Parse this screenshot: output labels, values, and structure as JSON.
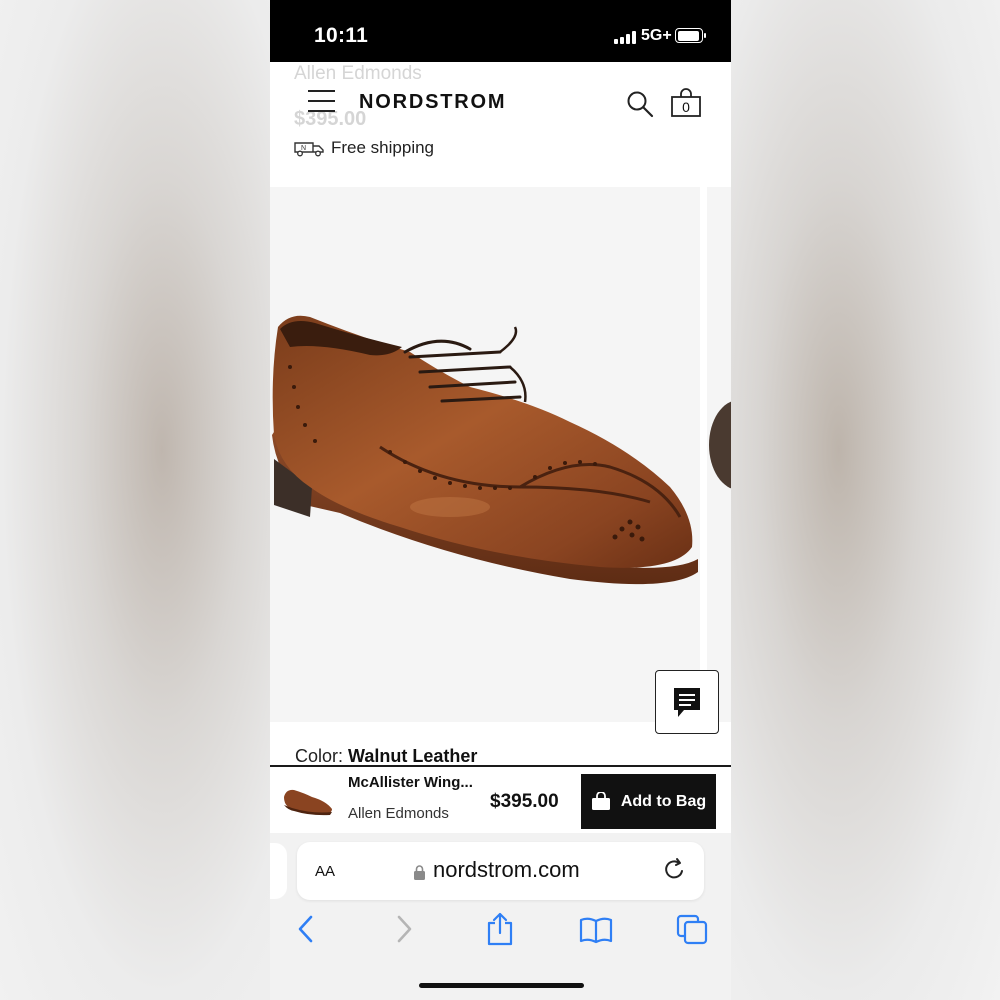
{
  "status_bar": {
    "time": "10:11",
    "network": "5G+"
  },
  "header": {
    "ghost_brand": "Allen Edmonds",
    "ghost_price": "$395.00",
    "logo": "NORDSTROM",
    "bag_count": "0",
    "shipping": "Free shipping"
  },
  "product": {
    "color_label": "Color: ",
    "color_value": "Walnut Leather"
  },
  "sticky_bar": {
    "name": "McAllister Wing...",
    "brand": "Allen Edmonds",
    "price": "$395.00",
    "add_label": "Add to Bag"
  },
  "browser": {
    "aa_label": "AA",
    "url": "nordstrom.com"
  },
  "icons": [
    "menu-icon",
    "search-icon",
    "bag-icon",
    "truck-icon",
    "chat-icon",
    "lock-icon",
    "reload-icon",
    "back-icon",
    "forward-icon",
    "share-icon",
    "bookmarks-icon",
    "tabs-icon",
    "cart-icon"
  ],
  "colors": {
    "accent": "#111111",
    "link_blue": "#2f7ff5",
    "shoe_brown": "#8a4a25"
  }
}
